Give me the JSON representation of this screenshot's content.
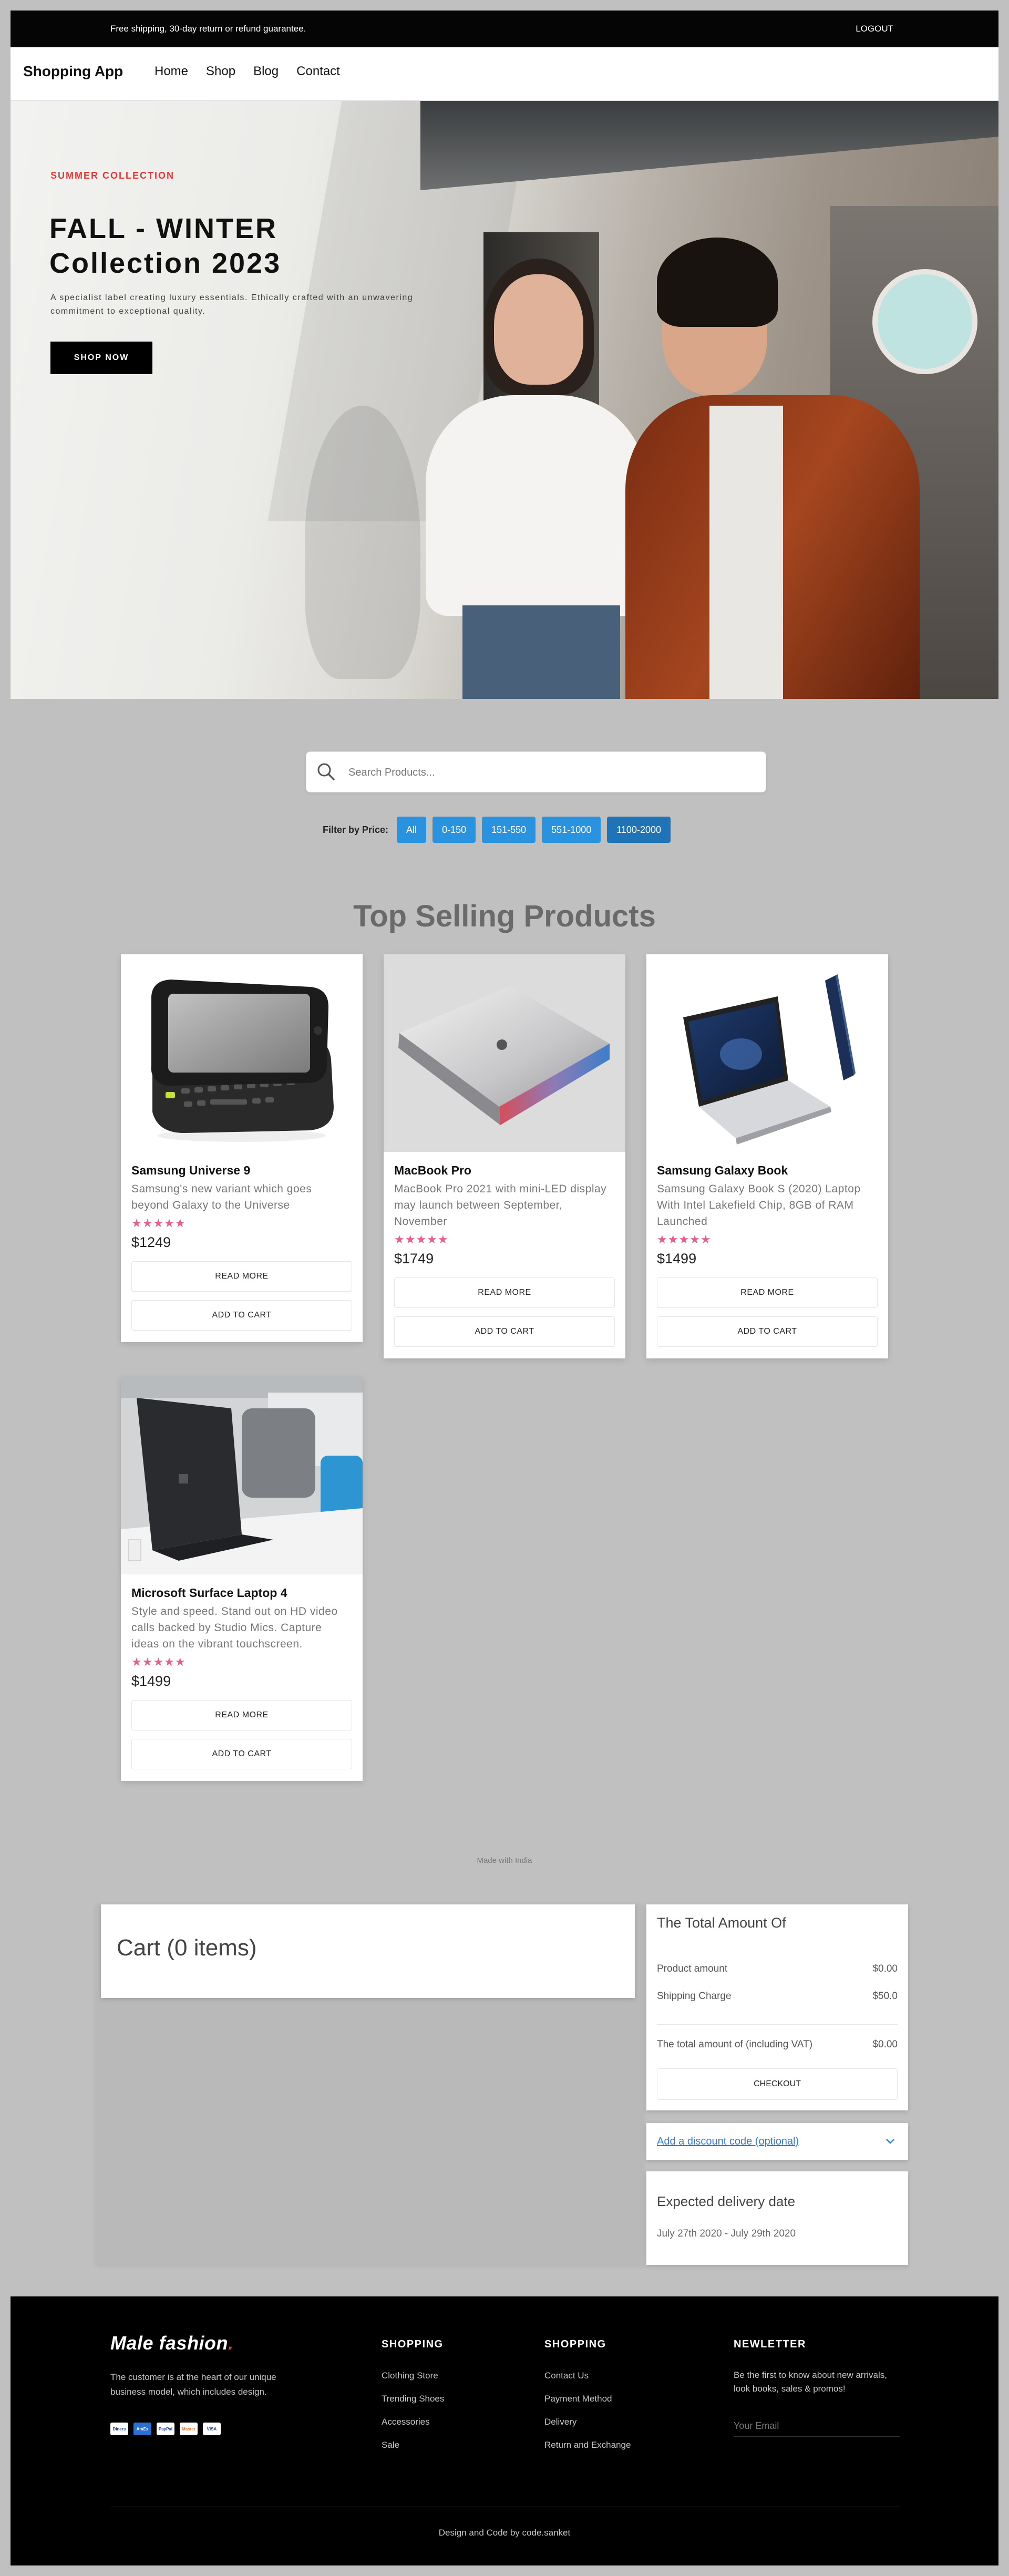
{
  "topbar": {
    "shipping": "Free shipping, 30-day return or refund guarantee.",
    "logout": "LOGOUT"
  },
  "nav": {
    "brand": "Shopping App",
    "links": [
      "Home",
      "Shop",
      "Blog",
      "Contact"
    ]
  },
  "hero": {
    "label": "SUMMER COLLECTION",
    "title_line1": "FALL - WINTER",
    "title_line2": "Collection 2023",
    "description": "A specialist label creating luxury essentials. Ethically crafted with an unwavering commitment to exceptional quality.",
    "cta": "SHOP NOW"
  },
  "search": {
    "placeholder": "Search Products..."
  },
  "filter": {
    "label": "Filter by Price:",
    "options": [
      "All",
      "0-150",
      "151-550",
      "551-1000",
      "1100-2000"
    ],
    "selected": "1100-2000"
  },
  "section_title": "Top Selling Products",
  "products": [
    {
      "name": "Samsung Universe 9",
      "description": "Samsung's new variant which goes beyond Galaxy to the Universe",
      "rating": 4.5,
      "stars": "★★★★★",
      "price": "$1249",
      "read_more": "READ MORE",
      "add_to_cart": "ADD TO CART"
    },
    {
      "name": "MacBook Pro",
      "description": "MacBook Pro 2021 with mini-LED display may launch between September, November",
      "rating": 4.5,
      "stars": "★★★★★",
      "price": "$1749",
      "read_more": "READ MORE",
      "add_to_cart": "ADD TO CART"
    },
    {
      "name": "Samsung Galaxy Book",
      "description": "Samsung Galaxy Book S (2020) Laptop With Intel Lakefield Chip, 8GB of RAM Launched",
      "rating": 4.5,
      "stars": "★★★★★",
      "price": "$1499",
      "read_more": "READ MORE",
      "add_to_cart": "ADD TO CART"
    },
    {
      "name": "Microsoft Surface Laptop 4",
      "description": "Style and speed. Stand out on HD video calls backed by Studio Mics. Capture ideas on the vibrant touchscreen.",
      "rating": 4.5,
      "stars": "★★★★★",
      "price": "$1499",
      "read_more": "READ MORE",
      "add_to_cart": "ADD TO CART"
    }
  ],
  "made_with": "Made with India",
  "cart": {
    "title": "Cart (0 items)"
  },
  "totals": {
    "title": "The Total Amount Of",
    "product_amount_label": "Product amount",
    "product_amount": "$0.00",
    "shipping_label": "Shipping Charge",
    "shipping": "$50.0",
    "total_label": "The total amount of (including VAT)",
    "total": "$0.00",
    "checkout": "CHECKOUT"
  },
  "discount": {
    "label": "Add a discount code (optional)"
  },
  "delivery": {
    "title": "Expected delivery date",
    "dates": "July 27th 2020 - July 29th 2020"
  },
  "footer": {
    "logo_text": "Male fashion",
    "logo_dot": ".",
    "about": "The customer is at the heart of our unique business model, which includes design.",
    "payment_icons": [
      "Diners",
      "AmEx",
      "PayPal",
      "Master",
      "VISA"
    ],
    "col1": {
      "title": "SHOPPING",
      "items": [
        "Clothing Store",
        "Trending Shoes",
        "Accessories",
        "Sale"
      ]
    },
    "col2": {
      "title": "SHOPPING",
      "items": [
        "Contact Us",
        "Payment Method",
        "Delivery",
        "Return and Exchange"
      ]
    },
    "newsletter": {
      "title": "NEWLETTER",
      "text": "Be the first to know about new arrivals, look books, sales & promos!",
      "placeholder": "Your Email"
    },
    "credit": "Design and Code by code.sanket"
  },
  "colors": {
    "accent_red": "#e53637",
    "filter_blue": "#2a93e0",
    "link_blue": "#2a7de1",
    "star_pink": "#e75e8a",
    "page_bg": "#c0c0c0"
  }
}
